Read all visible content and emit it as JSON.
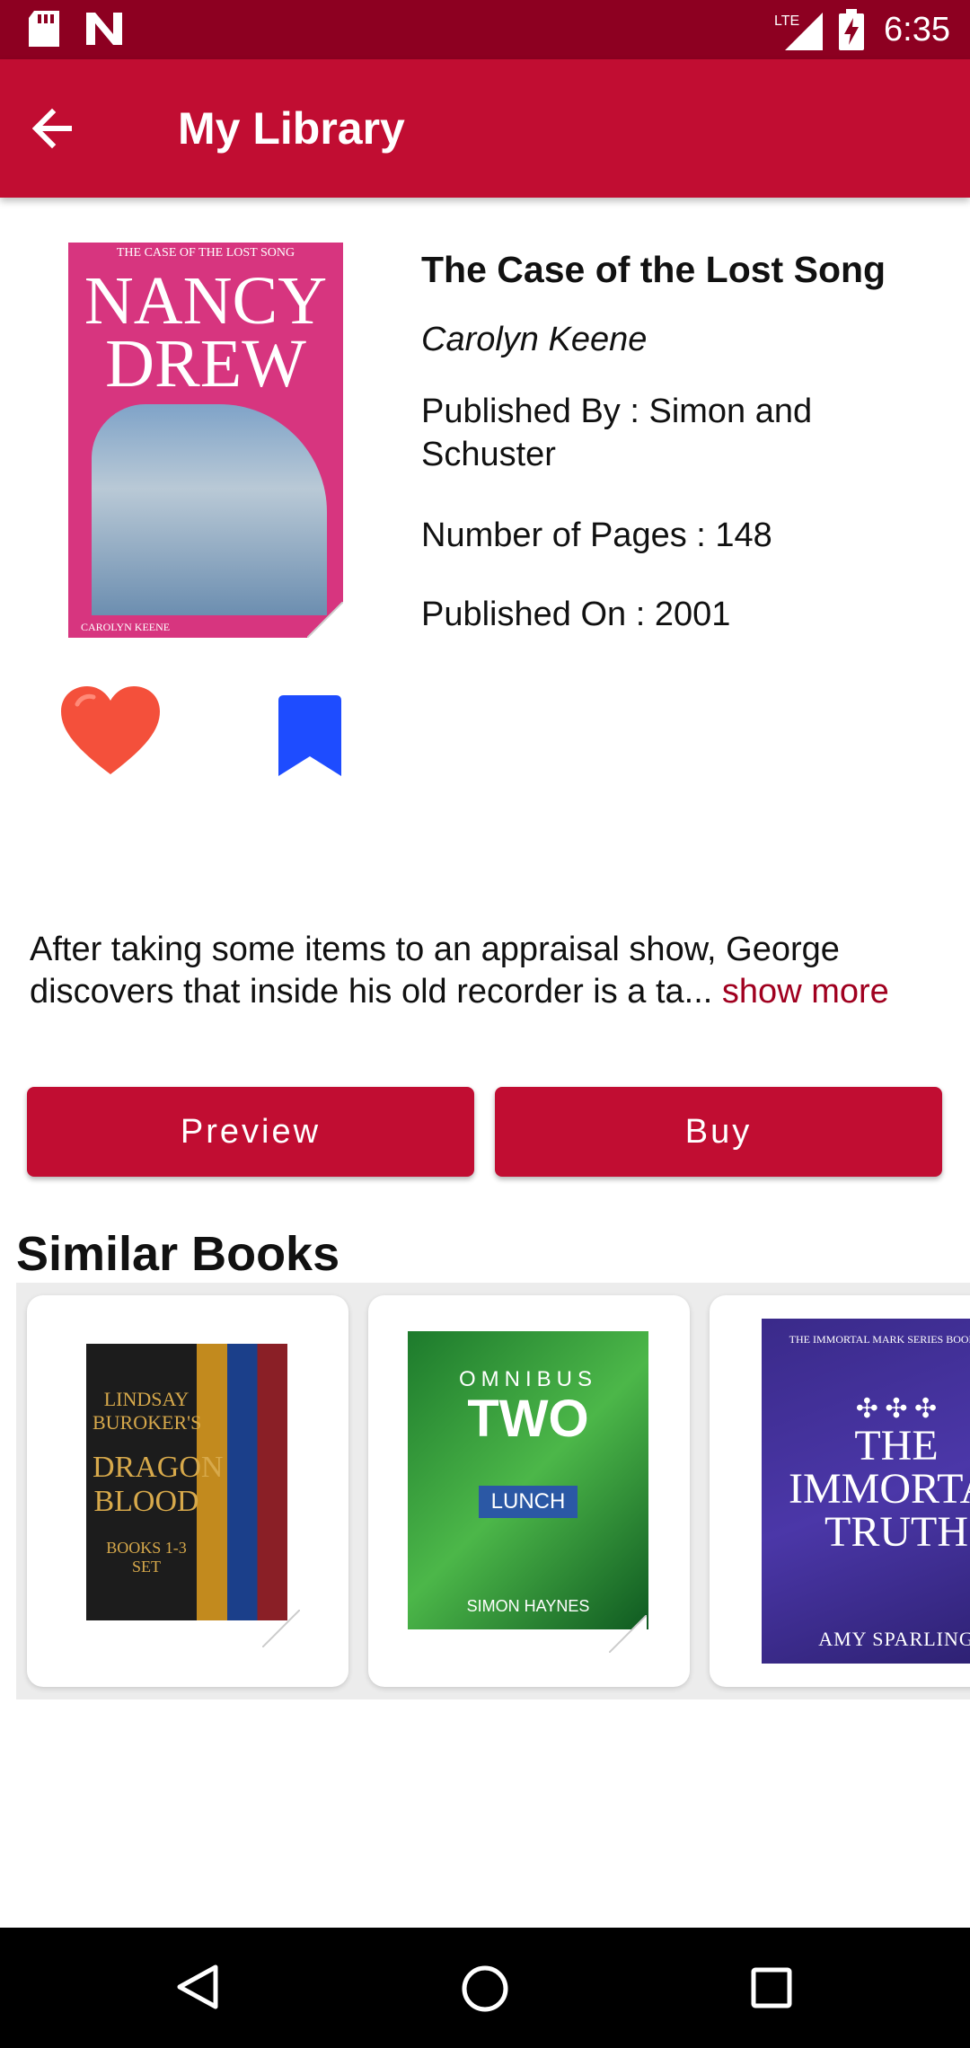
{
  "status_bar": {
    "time": "6:35",
    "lte_label": "LTE",
    "icons": [
      "sd-card-icon",
      "n-notification-icon",
      "lte-signal-icon",
      "battery-charging-icon"
    ]
  },
  "app_bar": {
    "title": "My Library",
    "back_icon": "arrow-back-icon"
  },
  "book": {
    "title": "The Case of the Lost Song",
    "author": "Carolyn Keene",
    "publisher": "Published By : Simon and Schuster",
    "pages": "Number of Pages : 148",
    "published_on": "Published On : 2001",
    "cover": {
      "top_text": "THE CASE OF THE LOST SONG",
      "brand": "NANCY DREW",
      "author": "CAROLYN KEENE"
    },
    "favorite_icon": "heart-icon",
    "favorite_color": "#f4503b",
    "bookmark_icon": "bookmark-icon",
    "bookmark_color": "#1e4cff",
    "description": "After taking some items to an appraisal show, George discovers that inside his old recorder is a ta... ",
    "show_more": "show more"
  },
  "actions": {
    "preview_label": "Preview",
    "buy_label": "Buy"
  },
  "similar": {
    "heading": "Similar Books",
    "books": [
      {
        "cover_lines": [
          "LINDSAY BUROKER'S",
          "DRAGON BLOOD",
          "BOOKS 1-3 SET"
        ]
      },
      {
        "cover_lines": [
          "OMNIBUS",
          "TWO",
          "LUNCH",
          "SIMON HAYNES"
        ]
      },
      {
        "cover_lines": [
          "THE IMMORTAL MARK SERIES BOOK TWO",
          "✣ ✣ ✣",
          "THE IMMORTAL TRUTH",
          "AMY SPARLING"
        ]
      }
    ]
  },
  "colors": {
    "status_bar": "#8d0021",
    "app_bar": "#c10d32",
    "accent": "#a0001f"
  },
  "nav_bar": {
    "icons": [
      "nav-back-icon",
      "nav-home-icon",
      "nav-recents-icon"
    ]
  }
}
